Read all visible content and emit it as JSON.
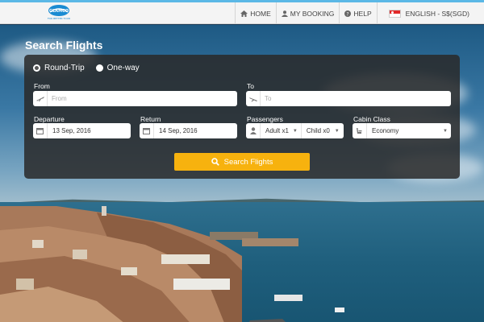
{
  "header": {
    "logo_text": "GLAMCO",
    "logo_tagline": "FOR BETTER TOUR",
    "nav": [
      {
        "icon": "home-icon",
        "label": "HOME"
      },
      {
        "icon": "user-icon",
        "label": "MY BOOKING"
      },
      {
        "icon": "help-icon",
        "label": "HELP"
      }
    ],
    "language": {
      "flag": "singapore-flag-icon",
      "label": "ENGLISH - S$(SGD)"
    }
  },
  "search": {
    "title": "Search Flights",
    "trip_types": [
      {
        "label": "Round-Trip",
        "selected": true
      },
      {
        "label": "One-way",
        "selected": false
      }
    ],
    "from": {
      "label": "From",
      "placeholder": "From",
      "icon": "plane-depart-icon"
    },
    "to": {
      "label": "To",
      "placeholder": "To",
      "icon": "plane-arrive-icon"
    },
    "departure": {
      "label": "Departure",
      "value": "13 Sep, 2016",
      "icon": "calendar-icon"
    },
    "return": {
      "label": "Return",
      "value": "14 Sep, 2016",
      "icon": "calendar-icon"
    },
    "passengers": {
      "label": "Passengers",
      "adult": "Adult x1",
      "child": "Child x0",
      "icon": "person-icon"
    },
    "cabin": {
      "label": "Cabin Class",
      "value": "Economy",
      "icon": "seat-icon"
    },
    "button_label": "Search Flights",
    "button_icon": "search-icon"
  },
  "colors": {
    "accent": "#f7b20e",
    "header_bg": "#f4f4f4",
    "panel_bg": "#2a2a2a"
  }
}
